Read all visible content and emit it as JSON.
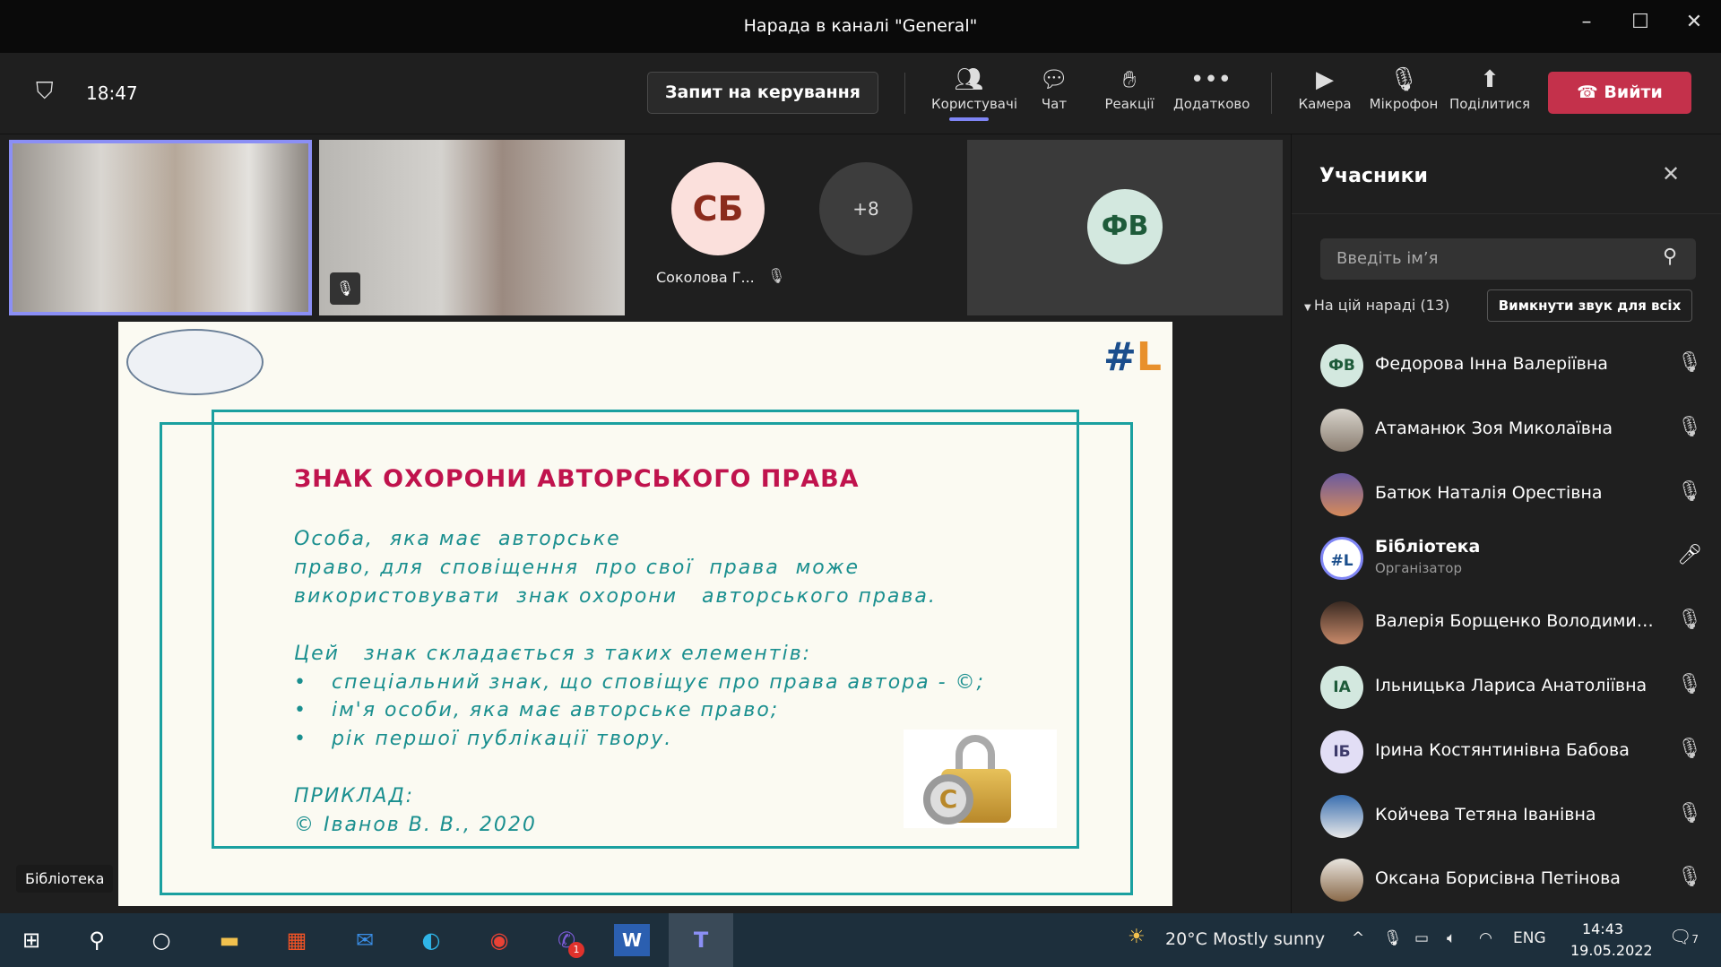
{
  "window": {
    "title": "Нарада в каналі \"General\"",
    "minimize": "–",
    "maximize": "☐",
    "close": "✕"
  },
  "toolbar": {
    "time": "18:47",
    "request_control": "Запит на керування",
    "people": "Користувачі",
    "chat": "Чат",
    "reactions": "Реакції",
    "more": "Додатково",
    "camera": "Камера",
    "mic": "Мікрофон",
    "share": "Поділитися",
    "leave": "Вийти"
  },
  "videos": {
    "sb_initials": "СБ",
    "sb_name": "Соколова Г...",
    "overflow": "+8",
    "fv_initials": "ФВ",
    "self_label": "Бібліотека"
  },
  "panel": {
    "title": "Учасники",
    "search_placeholder": "Введіть ім’я",
    "section": "На цій нараді (13)",
    "mute_all": "Вимкнути звук для всіх",
    "participants": [
      {
        "initials": "ФВ",
        "name": "Федорова Інна Валеріївна",
        "muted": true
      },
      {
        "initials": "",
        "name": "Атаманюк Зоя Миколаївна",
        "muted": true
      },
      {
        "initials": "",
        "name": "Батюк Наталія Орестівна",
        "muted": true
      },
      {
        "initials": "#L",
        "name": "Бібліотека",
        "role": "Організатор",
        "muted": false
      },
      {
        "initials": "",
        "name": "Валерія Борщенко Володимирі...",
        "muted": true
      },
      {
        "initials": "ІА",
        "name": "Ільницька Лариса Анатоліївна",
        "muted": true
      },
      {
        "initials": "ІБ",
        "name": "Ірина Костянтинівна Бабова",
        "muted": true
      },
      {
        "initials": "",
        "name": "Койчева Тетяна Іванівна",
        "muted": true
      },
      {
        "initials": "",
        "name": "Оксана Борисівна Петінова",
        "muted": true
      }
    ]
  },
  "slide": {
    "title": "ЗНАК ОХОРОНИ АВТОРСЬКОГО ПРАВА",
    "p1": [
      "Особа,  яка має  авторське",
      "право, для  сповіщення  про свої  права  може",
      "використовувати  знак охорони   авторського права."
    ],
    "p2": "Цей   знак складається з таких елементів:",
    "bullets": [
      "спеціальний знак, що сповіщує про права автора - ©;",
      "ім'я особи, яка має авторське право;",
      "рік першої публікації твору."
    ],
    "example_label": "ПРИКЛАД:",
    "example": "© Іванов В. В., 2020"
  },
  "taskbar": {
    "weather": "20°C  Mostly sunny",
    "lang": "ENG",
    "time": "14:43",
    "date": "19.05.2022",
    "viber_badge": "1",
    "notifications": "7"
  },
  "colors": {
    "leave": "#c4314b",
    "accent": "#7f85f5",
    "slide_title": "#c0134d",
    "slide_text": "#1a8f8f"
  }
}
